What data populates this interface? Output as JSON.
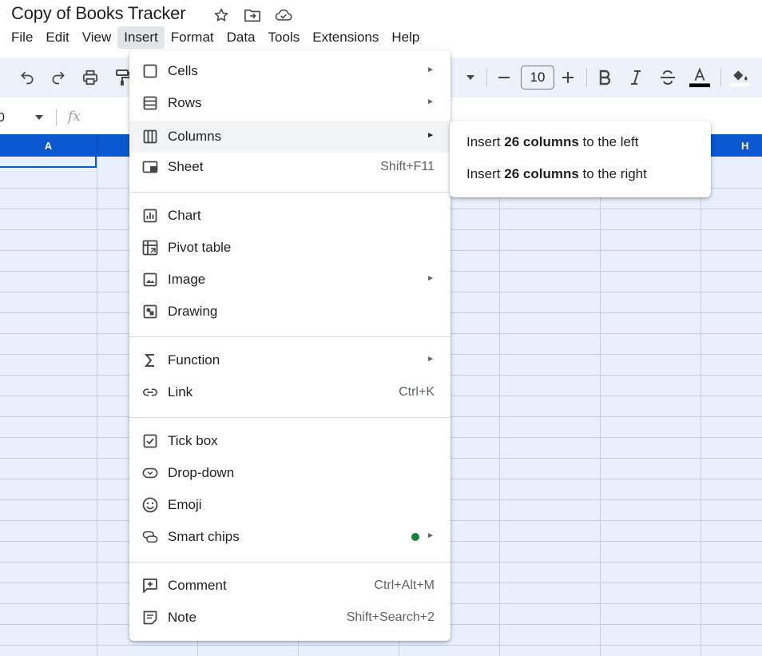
{
  "doc": {
    "title": "Copy of Books Tracker"
  },
  "menubar": [
    "File",
    "Edit",
    "View",
    "Insert",
    "Format",
    "Data",
    "Tools",
    "Extensions",
    "Help"
  ],
  "toolbar": {
    "font_size": "10"
  },
  "name_box": "0",
  "columns": {
    "a": "A",
    "h": "H"
  },
  "insert_menu": {
    "cells": {
      "label": "Cells"
    },
    "rows": {
      "label": "Rows"
    },
    "columns": {
      "label": "Columns"
    },
    "sheet": {
      "label": "Sheet",
      "shortcut": "Shift+F11"
    },
    "chart": {
      "label": "Chart"
    },
    "pivot": {
      "label": "Pivot table"
    },
    "image": {
      "label": "Image"
    },
    "drawing": {
      "label": "Drawing"
    },
    "function": {
      "label": "Function"
    },
    "link": {
      "label": "Link",
      "shortcut": "Ctrl+K"
    },
    "tickbox": {
      "label": "Tick box"
    },
    "dropdown": {
      "label": "Drop-down"
    },
    "emoji": {
      "label": "Emoji"
    },
    "smartchips": {
      "label": "Smart chips"
    },
    "comment": {
      "label": "Comment",
      "shortcut": "Ctrl+Alt+M"
    },
    "note": {
      "label": "Note",
      "shortcut": "Shift+Search+2"
    }
  },
  "columns_submenu": {
    "left": {
      "pre": "Insert ",
      "bold": "26 columns",
      "post": " to the left"
    },
    "right": {
      "pre": "Insert ",
      "bold": "26 columns",
      "post": " to the right"
    }
  },
  "colors": {
    "accent": "#0b57d0",
    "toolbar_bg": "#edf2fa",
    "selection_bg": "#e8f0fe",
    "status_dot": "#188038"
  }
}
